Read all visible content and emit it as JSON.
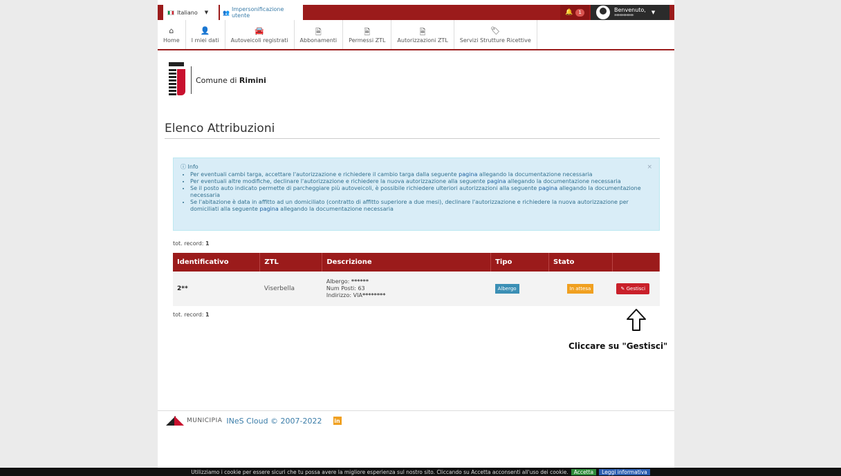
{
  "topbar": {
    "language": "Italiano",
    "impersonation": "Impersonificazione utente",
    "notifications_count": "1",
    "welcome": "Benvenuto,",
    "username": "***********"
  },
  "nav": [
    {
      "label": "Home",
      "icon": "home-icon",
      "glyph": "⌂"
    },
    {
      "label": "I miei dati",
      "icon": "user-icon",
      "glyph": "👤"
    },
    {
      "label": "Autoveicoli registrati",
      "icon": "car-icon",
      "glyph": "🚘"
    },
    {
      "label": "Abbonamenti",
      "icon": "document-icon",
      "glyph": "🗎"
    },
    {
      "label": "Permessi ZTL",
      "icon": "document-icon",
      "glyph": "🗎"
    },
    {
      "label": "Autorizzazioni ZTL",
      "icon": "document-icon",
      "glyph": "🗎"
    },
    {
      "label": "Servizi Strutture Ricettive",
      "icon": "tags-icon",
      "glyph": "🏷"
    }
  ],
  "logo": {
    "prefix": "Comune di ",
    "city": "Rimini"
  },
  "page_title": "Elenco Attribuzioni",
  "info": {
    "heading": "Info",
    "items": [
      {
        "pre": "Per eventuali cambi targa, accettare l'autorizzazione e richiedere il cambio targa dalla seguente ",
        "link": "pagina",
        "post": " allegando la documentazione necessaria"
      },
      {
        "pre": "Per eventuali altre modifiche, declinare l'autorizzazione e richiedere la nuova autorizzazione alla seguente ",
        "link": "pagina",
        "post": " allegando la documentazione necessaria"
      },
      {
        "pre": "Se il posto auto indicato permette di parcheggiare più autoveicoli, è possibile richiedere ulteriori autorizzazioni alla seguente ",
        "link": "pagina",
        "post": " allegando la documentazione necessaria"
      },
      {
        "pre": "Se l'abitazione è data in affitto ad un domiciliato (contratto di affitto superiore a due mesi), declinare l'autorizzazione e richiedere la nuova autorizzazione per domiciliati alla seguente ",
        "link": "pagina",
        "post": " allegando la documentazione necessaria"
      }
    ]
  },
  "records": {
    "label": "tot. record: ",
    "count": "1"
  },
  "table": {
    "headers": [
      "Identificativo",
      "ZTL",
      "Descrizione",
      "Tipo",
      "Stato",
      ""
    ],
    "row": {
      "id": "2**",
      "ztl": "Viserbella",
      "albergo_label": "Albergo: ",
      "albergo_value": "******",
      "posti_label": "Num Posti: ",
      "posti_value": "63",
      "indirizzo_label": "Indirizzo: VIA",
      "indirizzo_value": "********",
      "tipo": "Albergo",
      "stato": "In attesa",
      "action": "Gestisci"
    }
  },
  "annotation": "Cliccare su \"Gestisci\"",
  "footer": {
    "municipia": "MUNICIPIA",
    "copyright": "INeS Cloud © 2007-2022",
    "social": "in"
  },
  "cookie": {
    "text": "Utilizziamo i cookie per essere sicuri che tu possa avere la migliore esperienza sul nostro sito. Cliccando su Accetta acconsenti all'uso dei cookie.",
    "accept": "Accetta",
    "read": "Leggi informativa"
  }
}
